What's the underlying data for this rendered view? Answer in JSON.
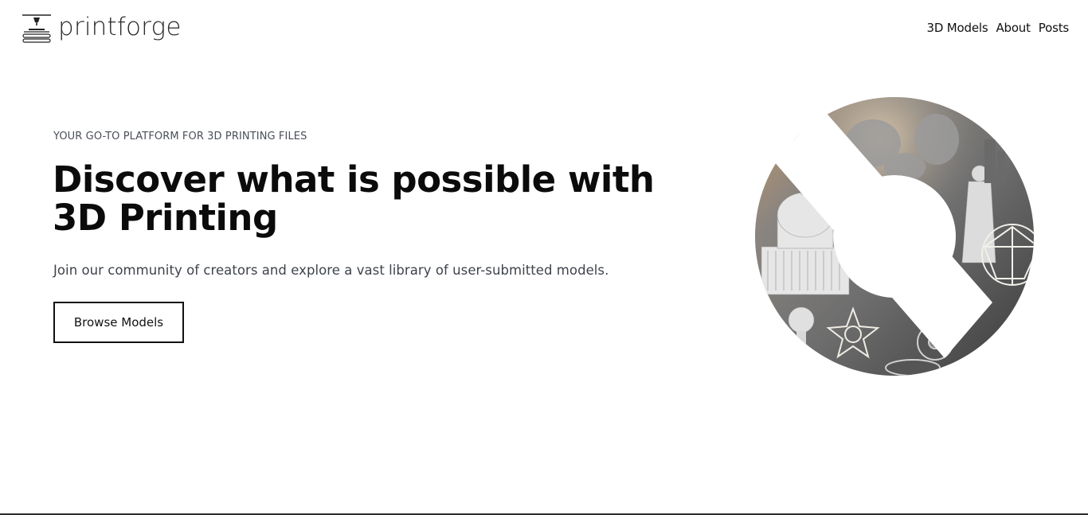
{
  "header": {
    "logo_text": "printforge",
    "logo_icon": "3d-printer-icon",
    "nav": [
      {
        "label": "3D Models"
      },
      {
        "label": "About"
      },
      {
        "label": "Posts"
      }
    ]
  },
  "hero": {
    "eyebrow": "YOUR GO-TO PLATFORM FOR 3D PRINTING FILES",
    "headline_line1": "Discover what is possible with",
    "headline_line2": "3D Printing",
    "subtext": "Join our community of creators and explore a vast library of user-submitted models.",
    "cta_label": "Browse Models"
  },
  "colors": {
    "text": "#0b0b0b",
    "muted": "#4a4f58",
    "background": "#ffffff"
  }
}
